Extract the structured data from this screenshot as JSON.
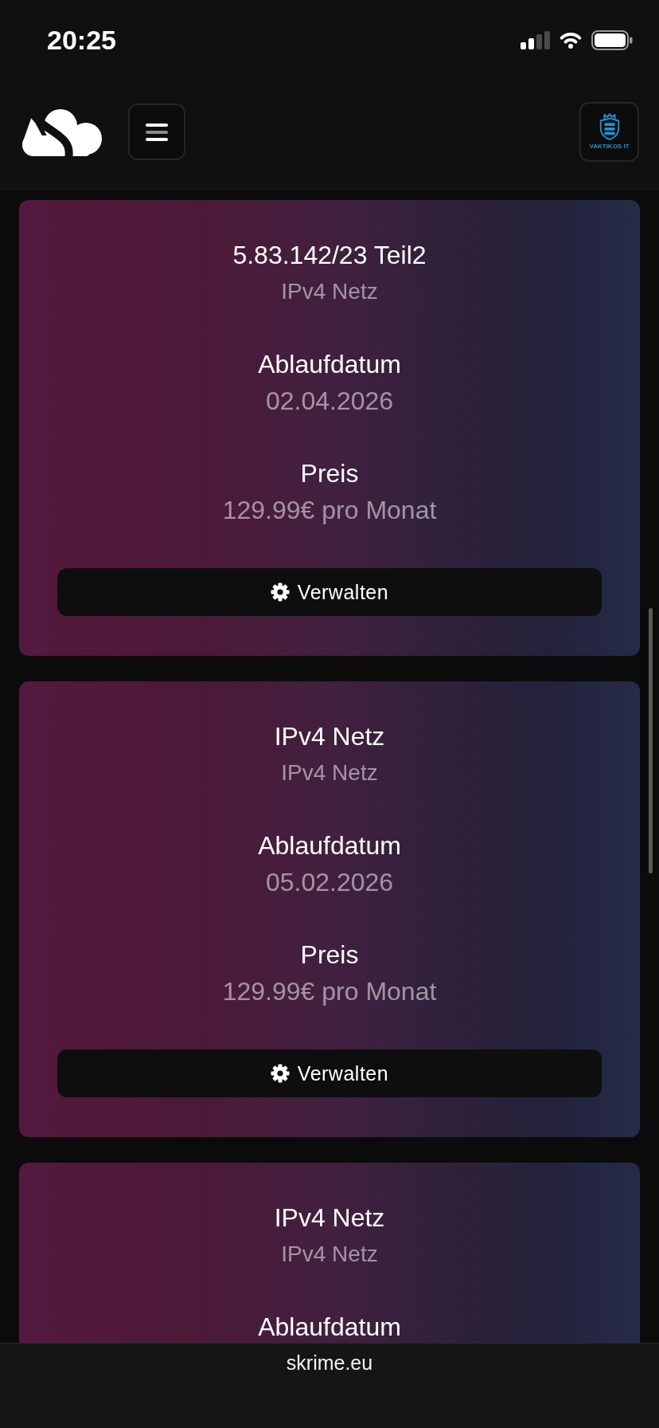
{
  "status_bar": {
    "time": "20:25"
  },
  "header": {
    "brand_button": {
      "label": "VAKTIKOS IT"
    }
  },
  "services": [
    {
      "title": "5.83.142/23 Teil2",
      "subtitle": "IPv4 Netz",
      "fields": [
        {
          "label": "Ablaufdatum",
          "value": "02.04.2026"
        },
        {
          "label": "Preis",
          "value": "129.99€ pro Monat"
        }
      ],
      "button": {
        "label": "Verwalten"
      }
    },
    {
      "title": "IPv4 Netz",
      "subtitle": "IPv4 Netz",
      "fields": [
        {
          "label": "Ablaufdatum",
          "value": "05.02.2026"
        },
        {
          "label": "Preis",
          "value": "129.99€ pro Monat"
        }
      ],
      "button": {
        "label": "Verwalten"
      }
    },
    {
      "title": "IPv4 Netz",
      "subtitle": "IPv4 Netz",
      "fields": [
        {
          "label": "Ablaufdatum"
        }
      ]
    }
  ],
  "browser_bar": {
    "url": "skrime.eu"
  }
}
